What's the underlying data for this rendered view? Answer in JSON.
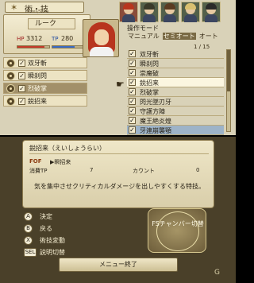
{
  "header": {
    "title": "術・技",
    "subtitle": "Artes/Skills"
  },
  "character": {
    "name": "ルーク",
    "hp_label": "HP",
    "hp": "3312",
    "hp_fill": 0.85,
    "tp_label": "TP",
    "tp": "280",
    "tp_fill": 0.7
  },
  "equipped": [
    {
      "label": "双牙斬",
      "checked": true
    },
    {
      "label": "瞬刹閃",
      "checked": true
    },
    {
      "label": "烈破掌",
      "checked": true,
      "selected": true
    },
    {
      "label": "鋭招来",
      "checked": true
    }
  ],
  "mode": {
    "title": "操作モード",
    "options": [
      "マニュアル",
      "セミオート",
      "オート"
    ],
    "active": 1
  },
  "page": "1 / 15",
  "skills": [
    {
      "label": "双牙斬",
      "checked": true
    },
    {
      "label": "瞬刹閃",
      "checked": true
    },
    {
      "label": "崇魔破",
      "checked": true
    },
    {
      "label": "鋭招来",
      "checked": true,
      "selected": true
    },
    {
      "label": "烈破掌",
      "checked": true
    },
    {
      "label": "閃光墜刃牙",
      "checked": true
    },
    {
      "label": "守護方陣",
      "checked": true
    },
    {
      "label": "魔王絶炎煌",
      "checked": true
    },
    {
      "label": "牙連崩襲顎",
      "checked": true,
      "highlight": true
    }
  ],
  "detail": {
    "title": "鋭招来（えいしょうらい）",
    "fof_label": "FOF",
    "fof_skill": "▶瞬招来",
    "cost_label": "消費TP",
    "cost": "7",
    "count_label": "カウント",
    "count": "0",
    "description": "気を集中させクリティカルダメージを出しやすくする特技。"
  },
  "controls": [
    {
      "button": "A",
      "label": "決定"
    },
    {
      "button": "B",
      "label": "戻る"
    },
    {
      "button": "X",
      "label": "術技変動"
    },
    {
      "button": "SEL",
      "label": "説明切替"
    }
  ],
  "fs_button": "FSチャンバー切替",
  "menu_end": "メニュー終了",
  "watermark": "G"
}
